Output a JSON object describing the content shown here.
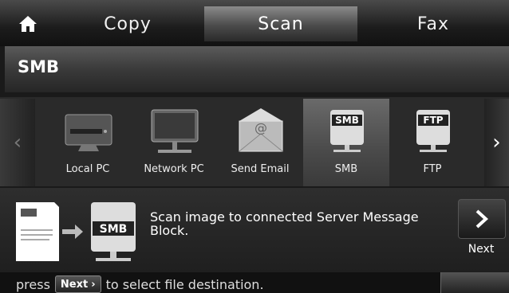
{
  "tabs": {
    "home_icon": "home-icon",
    "copy": "Copy",
    "scan": "Scan",
    "fax": "Fax",
    "selected": "Scan"
  },
  "header": {
    "title": "SMB"
  },
  "destinations": [
    {
      "label": "Local PC",
      "icon": "local-pc-icon"
    },
    {
      "label": "Network PC",
      "icon": "network-pc-icon"
    },
    {
      "label": "Send Email",
      "icon": "send-email-icon"
    },
    {
      "label": "SMB",
      "icon": "smb-icon",
      "selected": true
    },
    {
      "label": "FTP",
      "icon": "ftp-icon"
    }
  ],
  "info": {
    "description": "Scan image to connected Server Message Block.",
    "icon_label": "SMB"
  },
  "next_button": {
    "label": "Next"
  },
  "footer": {
    "prefix": "press",
    "button": "Next",
    "suffix": "to  select file destination."
  },
  "colors": {
    "selected_tab": "#6a6a6a",
    "background": "#1a1a1a"
  }
}
